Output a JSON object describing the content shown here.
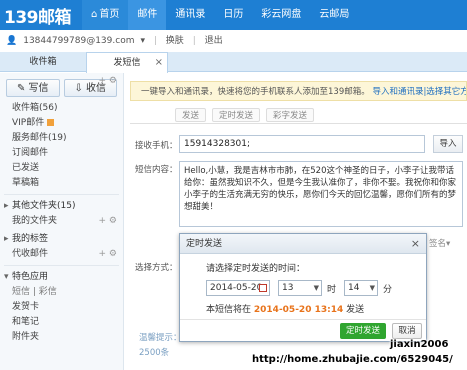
{
  "app": {
    "logo": "139邮箱"
  },
  "nav": [
    {
      "label": "首页",
      "icon": "home-icon"
    },
    {
      "label": "邮件"
    },
    {
      "label": "通讯录"
    },
    {
      "label": "日历"
    },
    {
      "label": "彩云网盘"
    },
    {
      "label": "云邮局"
    }
  ],
  "account": {
    "email": "13844799789@139.com",
    "switch": "换肤",
    "logout": "退出",
    "sep": "|"
  },
  "tabs": {
    "inbox": "收件箱",
    "compose_sms": "发短信",
    "close": "×"
  },
  "sidebar": {
    "write": "写信",
    "receive": "收信",
    "items": [
      "收件箱(56)",
      "VIP邮件",
      "服务邮件(19)",
      "订阅邮件",
      "已发送",
      "草稿箱"
    ],
    "other_folders": "其他文件夹(15)",
    "my_folders": "我的文件夹",
    "my_tags": "我的标签",
    "proxy_mail": "代收邮件",
    "features": "特色应用",
    "feature_sub": "短信 | 彩信",
    "feature_items": [
      "发贺卡",
      "和笔记",
      "附件夹"
    ],
    "add": "+ ⚙"
  },
  "content": {
    "notice_text": "一键导入和通讯录，快速将您的手机联系人添加至139邮箱。",
    "notice_link": "导入和通讯录|选择其它方式",
    "sub_tabs": [
      "发送",
      "定时发送",
      "彩字发送"
    ],
    "recipient_label": "接收手机：",
    "recipient_value": "15914328301;",
    "import_btn": "导入",
    "sms_label": "短信内容：",
    "sms_text": "Hello,小慧，我是吉林市市肺，在520这个神圣的日子，小李子让我带话给你：虽然我知识不久，但是今生我认准你了，非你不娶。我祝你和你家小李子的生活充满无穷的快乐，愿你们今天的回忆温馨，愿你们所有的梦想甜美！",
    "signature": "签名",
    "choose_label": "选择方式：",
    "warm_tip": "温馨提示：",
    "count_tip": "2500条"
  },
  "dialog": {
    "title": "定时发送",
    "close": "×",
    "prompt": "请选择定时发送的时间：",
    "date": "2014-05-20",
    "hour": "13",
    "hour_unit": "时",
    "minute": "14",
    "minute_unit": "分",
    "result_prefix": "本短信将在",
    "result_time": "2014-05-20 13:14",
    "result_suffix": "发送",
    "ok": "定时发送",
    "cancel": "取消"
  },
  "watermark": {
    "line1": "jiaxin2006",
    "line2": "http://home.zhubajie.com/6529045/"
  },
  "colors": {
    "nav_bg": "#1e7fd3",
    "ok_button": "#2fa52f",
    "highlight_time": "#e8731b"
  }
}
